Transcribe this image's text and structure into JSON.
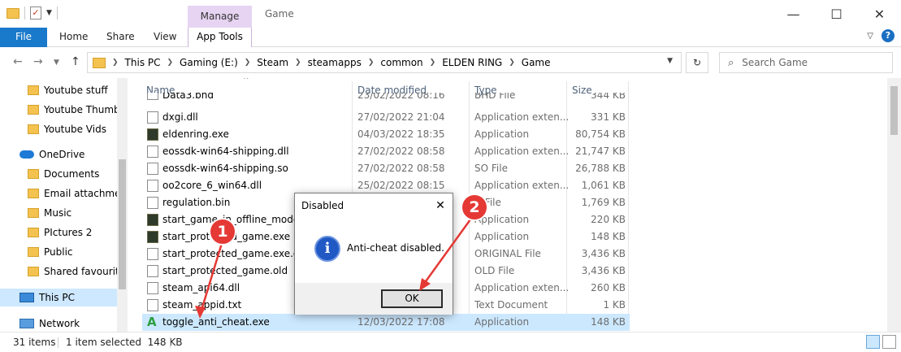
{
  "window": {
    "manage_tab": "Manage",
    "title": "Game",
    "controls": {
      "minimize": "—",
      "maximize": "☐",
      "close": "✕"
    }
  },
  "ribbon": {
    "file": "File",
    "home": "Home",
    "share": "Share",
    "view": "View",
    "app_tools": "App Tools",
    "help": "?"
  },
  "address": {
    "crumbs": [
      "This PC",
      "Gaming (E:)",
      "Steam",
      "steamapps",
      "common",
      "ELDEN RING",
      "Game"
    ],
    "search_placeholder": "Search Game"
  },
  "nav": {
    "items": [
      "Youtube stuff",
      "Youtube Thumb",
      "Youtube Vids",
      "OneDrive",
      "Documents",
      "Email attachmer",
      "Music",
      "PIctures 2",
      "Public",
      "Shared favourite",
      "This PC",
      "Network"
    ]
  },
  "columns": {
    "name": "Name",
    "date": "Date modified",
    "type": "Type",
    "size": "Size"
  },
  "files": [
    {
      "name": "Data3.bhd",
      "date": "23/02/2022 08:16",
      "type": "BHD File",
      "size": "344 KB",
      "icon": "file"
    },
    {
      "name": "dxgi.dll",
      "date": "27/02/2022 21:04",
      "type": "Application exten...",
      "size": "331 KB",
      "icon": "file"
    },
    {
      "name": "eldenring.exe",
      "date": "04/03/2022 18:35",
      "type": "Application",
      "size": "80,754 KB",
      "icon": "app"
    },
    {
      "name": "eossdk-win64-shipping.dll",
      "date": "27/02/2022 08:58",
      "type": "Application exten...",
      "size": "21,747 KB",
      "icon": "file"
    },
    {
      "name": "eossdk-win64-shipping.so",
      "date": "27/02/2022 08:58",
      "type": "SO File",
      "size": "26,788 KB",
      "icon": "file"
    },
    {
      "name": "oo2core_6_win64.dll",
      "date": "25/02/2022 08:15",
      "type": "Application exten...",
      "size": "1,061 KB",
      "icon": "file"
    },
    {
      "name": "regulation.bin",
      "date": "",
      "type": "N File",
      "size": "1,769 KB",
      "icon": "file"
    },
    {
      "name": "start_game_in_offline_mode.exe",
      "date": "",
      "type": "Application",
      "size": "220 KB",
      "icon": "app"
    },
    {
      "name": "start_protected_game.exe",
      "date": "",
      "type": "Application",
      "size": "148 KB",
      "icon": "app"
    },
    {
      "name": "start_protected_game.exe.original",
      "date": "",
      "type": "ORIGINAL File",
      "size": "3,436 KB",
      "icon": "file"
    },
    {
      "name": "start_protected_game.old",
      "date": "",
      "type": "OLD File",
      "size": "3,436 KB",
      "icon": "file"
    },
    {
      "name": "steam_api64.dll",
      "date": "",
      "type": "Application exten...",
      "size": "260 KB",
      "icon": "file"
    },
    {
      "name": "steam_appid.txt",
      "date": "",
      "type": "Text Document",
      "size": "1 KB",
      "icon": "file"
    },
    {
      "name": "toggle_anti_cheat.exe",
      "date": "12/03/2022 17:08",
      "type": "Application",
      "size": "148 KB",
      "icon": "toggle"
    }
  ],
  "dialog": {
    "title": "Disabled",
    "message": "Anti-cheat disabled.",
    "ok": "OK",
    "close": "✕",
    "info_glyph": "i"
  },
  "status": {
    "items": "31 items",
    "selected": "1 item selected  148 KB"
  },
  "annotations": {
    "marker1": "1",
    "marker2": "2",
    "color": "#e53935"
  }
}
